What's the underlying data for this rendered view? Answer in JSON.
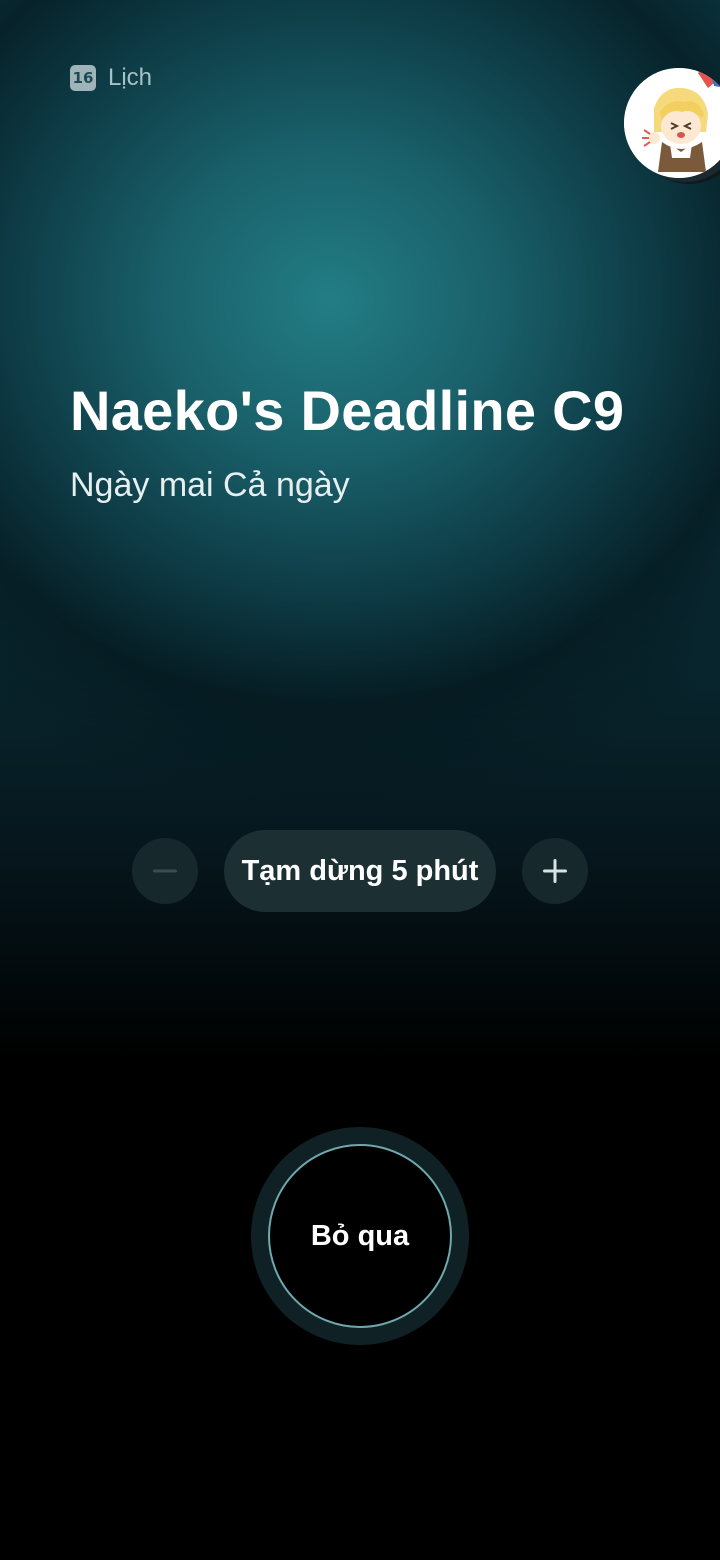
{
  "app": {
    "icon_text": "16",
    "name": "Lịch"
  },
  "event": {
    "title": "Naeko's Deadline C9",
    "time": "Ngày mai Cả ngày"
  },
  "snooze": {
    "label": "Tạm dừng 5 phút",
    "decrease_icon": "minus-icon",
    "increase_icon": "plus-icon"
  },
  "dismiss": {
    "label": "Bỏ qua"
  },
  "avatar": {
    "icon": "anime-character-avatar"
  },
  "colors": {
    "background_top": "#237d84",
    "background_bottom": "#000000",
    "pill_bg": "#1c2f33",
    "dismiss_ring": "#6fa8ad"
  }
}
